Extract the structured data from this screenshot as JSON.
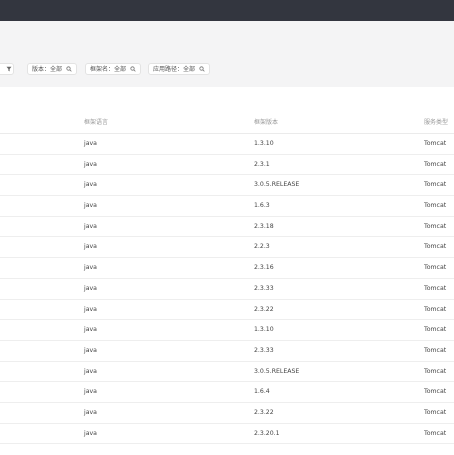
{
  "filters": [
    {
      "name": "version",
      "label": "版本：全部",
      "icon": "search-icon"
    },
    {
      "name": "framework",
      "label": "框架名：全部",
      "icon": "search-icon"
    },
    {
      "name": "app-path",
      "label": "应用路径：全部",
      "icon": "search-icon"
    }
  ],
  "table": {
    "columns": [
      "框架语言",
      "框架版本",
      "服务类型"
    ],
    "rows": [
      {
        "language": "java",
        "version": "1.3.10",
        "service": "Tomcat"
      },
      {
        "language": "java",
        "version": "2.3.1",
        "service": "Tomcat"
      },
      {
        "language": "java",
        "version": "3.0.5.RELEASE",
        "service": "Tomcat"
      },
      {
        "language": "java",
        "version": "1.6.3",
        "service": "Tomcat"
      },
      {
        "language": "java",
        "version": "2.3.18",
        "service": "Tomcat"
      },
      {
        "language": "java",
        "version": "2.2.3",
        "service": "Tomcat"
      },
      {
        "language": "java",
        "version": "2.3.16",
        "service": "Tomcat"
      },
      {
        "language": "java",
        "version": "2.3.33",
        "service": "Tomcat"
      },
      {
        "language": "java",
        "version": "2.3.22",
        "service": "Tomcat"
      },
      {
        "language": "java",
        "version": "1.3.10",
        "service": "Tomcat"
      },
      {
        "language": "java",
        "version": "2.3.33",
        "service": "Tomcat"
      },
      {
        "language": "java",
        "version": "3.0.5.RELEASE",
        "service": "Tomcat"
      },
      {
        "language": "java",
        "version": "1.6.4",
        "service": "Tomcat"
      },
      {
        "language": "java",
        "version": "2.3.22",
        "service": "Tomcat"
      },
      {
        "language": "java",
        "version": "2.3.20.1",
        "service": "Tomcat"
      }
    ]
  },
  "colors": {
    "topbar": "#33363f",
    "filterbar": "#f4f4f5"
  }
}
